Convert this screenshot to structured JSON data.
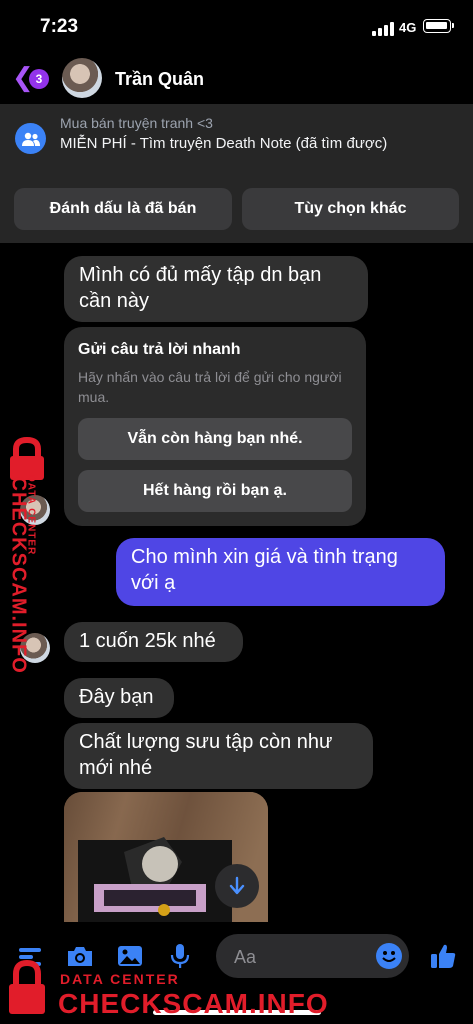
{
  "status_bar": {
    "time": "7:23",
    "network": "4G"
  },
  "header": {
    "back_count": "3",
    "contact_name": "Trần Quân"
  },
  "listing": {
    "title": "Mua bán truyện tranh <3",
    "subtitle": "MIỄN PHÍ - Tìm truyện Death Note (đã tìm được)",
    "mark_sold_label": "Đánh dấu là đã bán",
    "more_options_label": "Tùy chọn khác"
  },
  "messages": [
    {
      "direction": "out",
      "text": "Mình có đủ mấy tập dn bạn cần này"
    },
    {
      "direction": "in",
      "text": "Cho mình xin giá và tình trạng với ạ"
    },
    {
      "direction": "out",
      "text": "1 cuốn 25k nhé"
    },
    {
      "direction": "out",
      "text": "Đây bạn"
    },
    {
      "direction": "out",
      "text": "Chất lượng sưu tập còn như mới nhé"
    }
  ],
  "quick_reply": {
    "title": "Gửi câu trả lời nhanh",
    "hint": "Hãy nhấn vào câu trả lời để gửi cho người mua.",
    "options": [
      "Vẫn còn hàng bạn nhé.",
      "Hết hàng rồi bạn ạ."
    ]
  },
  "composer": {
    "placeholder": "Aa"
  },
  "watermark": {
    "side_brand": "CHECKSCAM.INFO",
    "side_caption": "DATA CENTER",
    "bottom_caption": "DATA CENTER",
    "bottom_brand": "CHECKSCAM.INFO"
  },
  "colors": {
    "outgoing_bubble": "#4f46e5",
    "incoming_bubble": "#303030",
    "accent": "#a855f7",
    "watermark": "#e11d2a"
  }
}
